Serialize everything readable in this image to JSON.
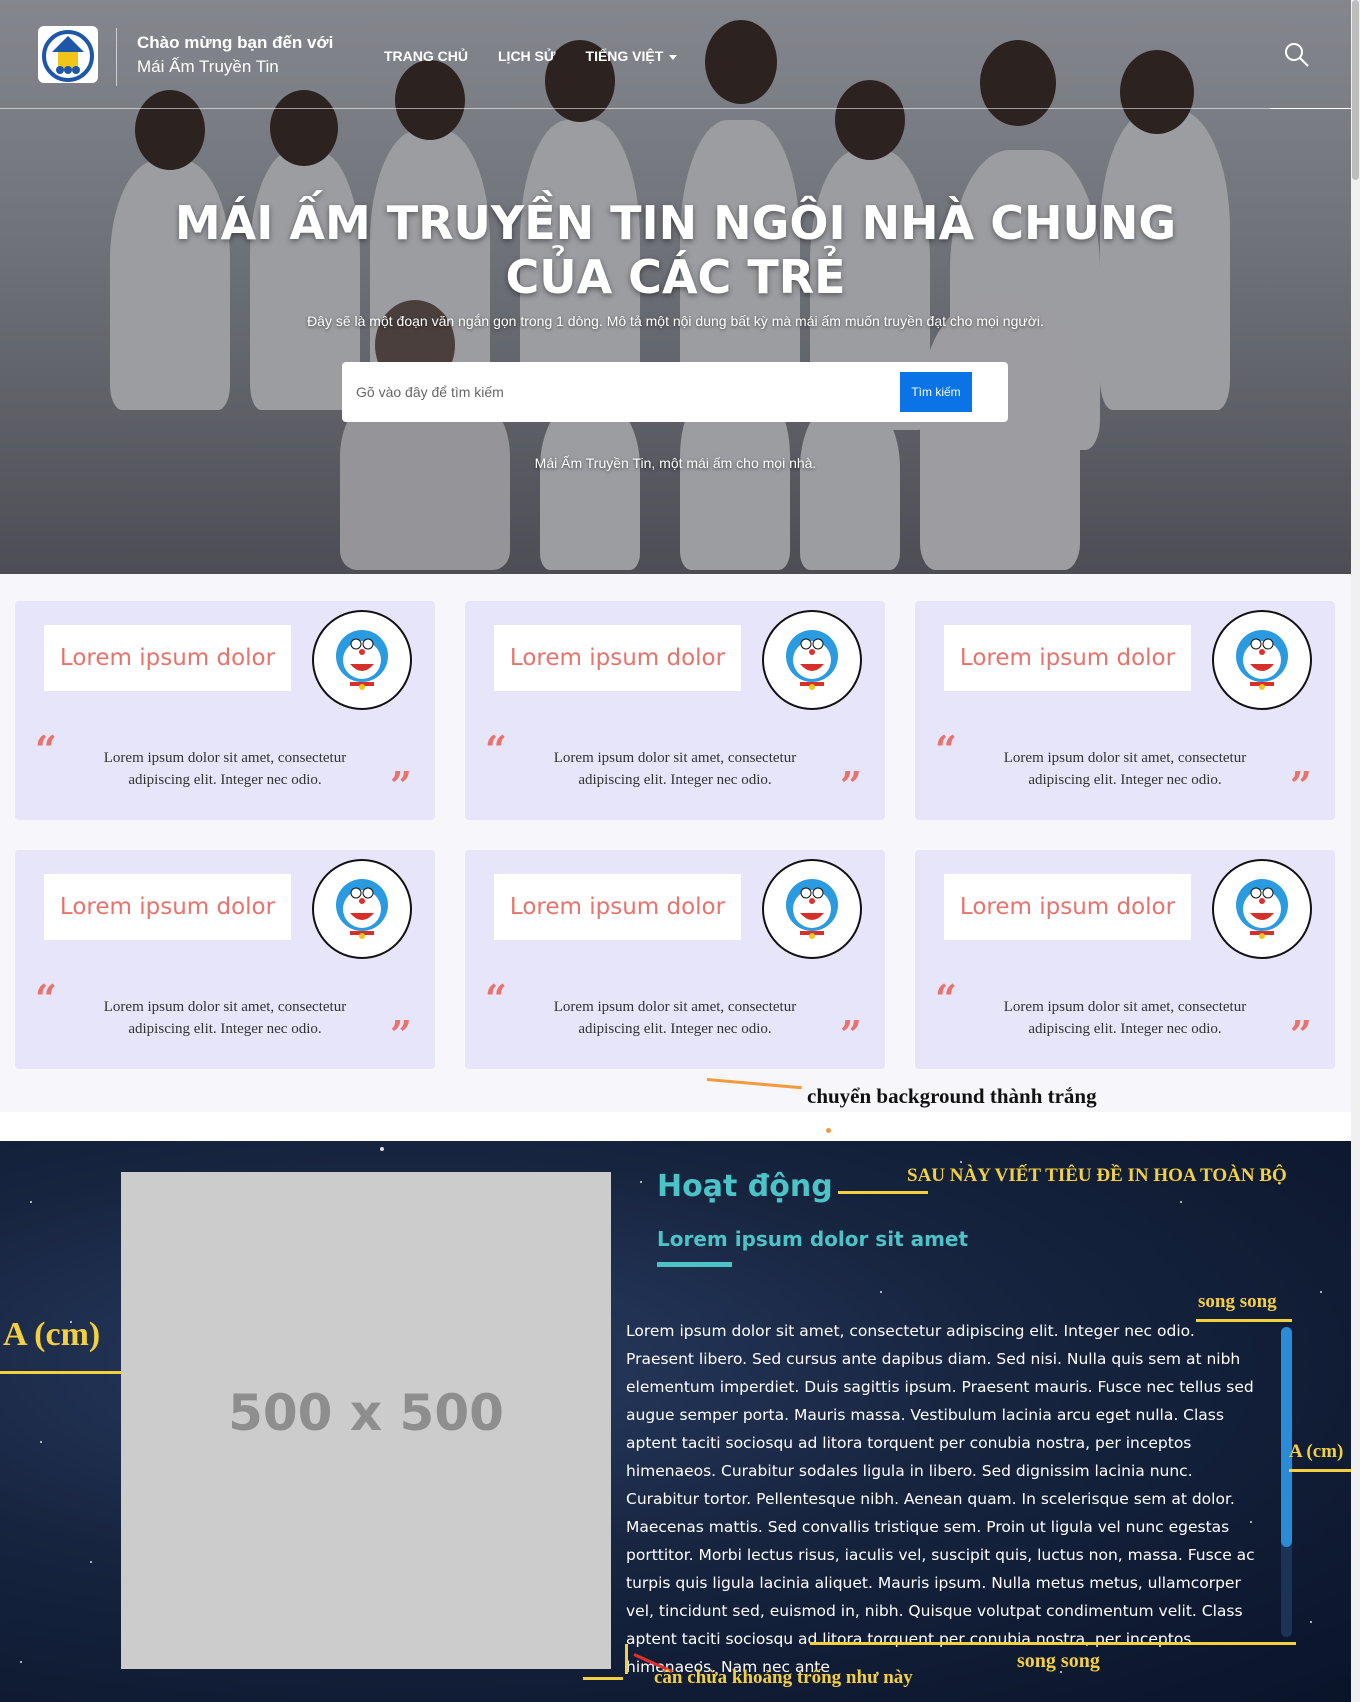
{
  "header": {
    "brand_line1": "Chào mừng bạn đến với",
    "brand_line2": "Mái Ấm Truyền Tin",
    "nav": [
      {
        "label": "TRANG CHỦ"
      },
      {
        "label": "LỊCH SỬ"
      },
      {
        "label": "TIẾNG VIỆT",
        "dropdown": true
      }
    ],
    "search_icon": "search-icon",
    "logo_icon": "home-logo-icon"
  },
  "hero": {
    "title_line1": "MÁI ẤM TRUYỀN TIN NGÔI NHÀ CHUNG",
    "title_line2": "CỦA CÁC TRẺ",
    "subtitle": "Đây sẽ là một đoạn văn ngắn gọn trong 1 dòng. Mô tả một nội dung bất kỳ mà mái ấm muốn truyền đạt cho mọi người.",
    "search_placeholder": "Gõ vào đây để tìm kiếm",
    "search_button": "Tìm kiếm",
    "tagline": "Mái Ấm Truyền Tin, một mái ấm cho mọi nhà."
  },
  "cards": [
    {
      "title": "Lorem ipsum dolor",
      "text": "Lorem ipsum dolor sit amet, consectetur adipiscing elit. Integer nec odio.",
      "avatar": "doraemon-avatar"
    },
    {
      "title": "Lorem ipsum dolor",
      "text": "Lorem ipsum dolor sit amet, consectetur adipiscing elit. Integer nec odio.",
      "avatar": "doraemon-avatar"
    },
    {
      "title": "Lorem ipsum dolor",
      "text": "Lorem ipsum dolor sit amet, consectetur adipiscing elit. Integer nec odio.",
      "avatar": "doraemon-avatar"
    },
    {
      "title": "Lorem ipsum dolor",
      "text": "Lorem ipsum dolor sit amet, consectetur adipiscing elit. Integer nec odio.",
      "avatar": "doraemon-avatar"
    },
    {
      "title": "Lorem ipsum dolor",
      "text": "Lorem ipsum dolor sit amet, consectetur adipiscing elit. Integer nec odio.",
      "avatar": "doraemon-avatar"
    },
    {
      "title": "Lorem ipsum dolor",
      "text": "Lorem ipsum dolor sit amet, consectetur adipiscing elit. Integer nec odio.",
      "avatar": "doraemon-avatar"
    }
  ],
  "quote_open": "“",
  "quote_close": "”",
  "activity": {
    "title": "Hoạt động",
    "subtitle": "Lorem ipsum dolor sit amet",
    "image_placeholder": "500 x 500",
    "body": "Lorem ipsum dolor sit amet, consectetur adipiscing elit. Integer nec odio. Praesent libero. Sed cursus ante dapibus diam. Sed nisi. Nulla quis sem at nibh elementum imperdiet. Duis sagittis ipsum. Praesent mauris. Fusce nec tellus sed augue semper porta. Mauris massa. Vestibulum lacinia arcu eget nulla. Class aptent taciti sociosqu ad litora torquent per conubia nostra, per inceptos himenaeos. Curabitur sodales ligula in libero. Sed dignissim lacinia nunc. Curabitur tortor. Pellentesque nibh. Aenean quam. In scelerisque sem at dolor. Maecenas mattis. Sed convallis tristique sem. Proin ut ligula vel nunc egestas porttitor. Morbi lectus risus, iaculis vel, suscipit quis, luctus non, massa. Fusce ac turpis quis ligula lacinia aliquet. Mauris ipsum. Nulla metus metus, ullamcorper vel, tincidunt sed, euismod in, nibh. Quisque volutpat condimentum velit. Class aptent taciti sociosqu ad litora torquent per conubia nostra, per inceptos himenaeos. Nam nec ante"
  },
  "annotations": {
    "bg_white": "chuyển background thành trắng",
    "uppercase_title": "SAU NÀY VIẾT TIÊU ĐỀ IN HOA TOÀN BỘ",
    "parallel_top": "song song",
    "parallel_bottom": "song song",
    "a_left": "A (cm)",
    "a_right": "A (cm)",
    "keep_space": "cần chừa khoảng trống như này"
  },
  "colors": {
    "accent_teal": "#4cc3c7",
    "card_bg": "#e6e5fa",
    "card_title": "#e8736c",
    "search_button": "#0a73e6",
    "annotation": "#f4d03f"
  }
}
